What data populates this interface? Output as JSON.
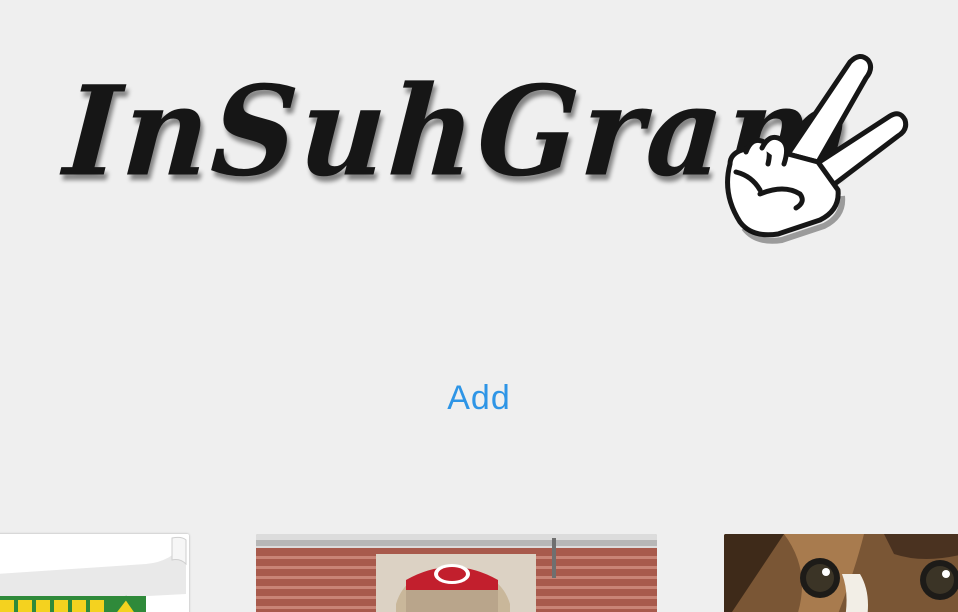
{
  "header": {
    "logo_text": "InSuhGram",
    "logo_icon": "peace-hand-icon"
  },
  "actions": {
    "add_label": "Add"
  },
  "gallery": {
    "items": [
      {
        "name": "photo-thumbnail-sign"
      },
      {
        "name": "photo-thumbnail-stadium"
      },
      {
        "name": "photo-thumbnail-cat"
      }
    ]
  },
  "colors": {
    "background": "#efefef",
    "accent": "#2e95e6",
    "logo": "#161616"
  }
}
